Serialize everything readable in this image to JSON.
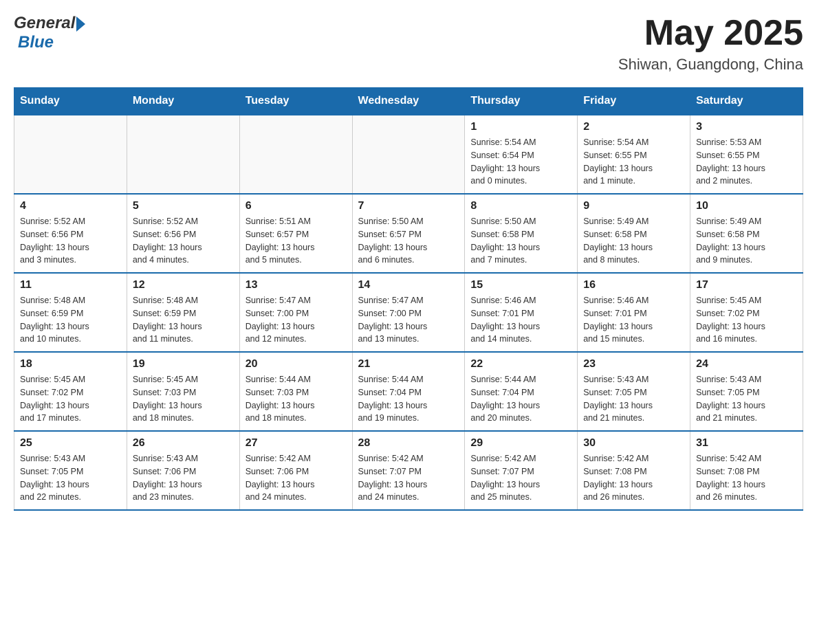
{
  "header": {
    "logo_general": "General",
    "logo_blue": "Blue",
    "month_year": "May 2025",
    "location": "Shiwan, Guangdong, China"
  },
  "weekdays": [
    "Sunday",
    "Monday",
    "Tuesday",
    "Wednesday",
    "Thursday",
    "Friday",
    "Saturday"
  ],
  "weeks": [
    [
      {
        "day": "",
        "info": ""
      },
      {
        "day": "",
        "info": ""
      },
      {
        "day": "",
        "info": ""
      },
      {
        "day": "",
        "info": ""
      },
      {
        "day": "1",
        "info": "Sunrise: 5:54 AM\nSunset: 6:54 PM\nDaylight: 13 hours\nand 0 minutes."
      },
      {
        "day": "2",
        "info": "Sunrise: 5:54 AM\nSunset: 6:55 PM\nDaylight: 13 hours\nand 1 minute."
      },
      {
        "day": "3",
        "info": "Sunrise: 5:53 AM\nSunset: 6:55 PM\nDaylight: 13 hours\nand 2 minutes."
      }
    ],
    [
      {
        "day": "4",
        "info": "Sunrise: 5:52 AM\nSunset: 6:56 PM\nDaylight: 13 hours\nand 3 minutes."
      },
      {
        "day": "5",
        "info": "Sunrise: 5:52 AM\nSunset: 6:56 PM\nDaylight: 13 hours\nand 4 minutes."
      },
      {
        "day": "6",
        "info": "Sunrise: 5:51 AM\nSunset: 6:57 PM\nDaylight: 13 hours\nand 5 minutes."
      },
      {
        "day": "7",
        "info": "Sunrise: 5:50 AM\nSunset: 6:57 PM\nDaylight: 13 hours\nand 6 minutes."
      },
      {
        "day": "8",
        "info": "Sunrise: 5:50 AM\nSunset: 6:58 PM\nDaylight: 13 hours\nand 7 minutes."
      },
      {
        "day": "9",
        "info": "Sunrise: 5:49 AM\nSunset: 6:58 PM\nDaylight: 13 hours\nand 8 minutes."
      },
      {
        "day": "10",
        "info": "Sunrise: 5:49 AM\nSunset: 6:58 PM\nDaylight: 13 hours\nand 9 minutes."
      }
    ],
    [
      {
        "day": "11",
        "info": "Sunrise: 5:48 AM\nSunset: 6:59 PM\nDaylight: 13 hours\nand 10 minutes."
      },
      {
        "day": "12",
        "info": "Sunrise: 5:48 AM\nSunset: 6:59 PM\nDaylight: 13 hours\nand 11 minutes."
      },
      {
        "day": "13",
        "info": "Sunrise: 5:47 AM\nSunset: 7:00 PM\nDaylight: 13 hours\nand 12 minutes."
      },
      {
        "day": "14",
        "info": "Sunrise: 5:47 AM\nSunset: 7:00 PM\nDaylight: 13 hours\nand 13 minutes."
      },
      {
        "day": "15",
        "info": "Sunrise: 5:46 AM\nSunset: 7:01 PM\nDaylight: 13 hours\nand 14 minutes."
      },
      {
        "day": "16",
        "info": "Sunrise: 5:46 AM\nSunset: 7:01 PM\nDaylight: 13 hours\nand 15 minutes."
      },
      {
        "day": "17",
        "info": "Sunrise: 5:45 AM\nSunset: 7:02 PM\nDaylight: 13 hours\nand 16 minutes."
      }
    ],
    [
      {
        "day": "18",
        "info": "Sunrise: 5:45 AM\nSunset: 7:02 PM\nDaylight: 13 hours\nand 17 minutes."
      },
      {
        "day": "19",
        "info": "Sunrise: 5:45 AM\nSunset: 7:03 PM\nDaylight: 13 hours\nand 18 minutes."
      },
      {
        "day": "20",
        "info": "Sunrise: 5:44 AM\nSunset: 7:03 PM\nDaylight: 13 hours\nand 18 minutes."
      },
      {
        "day": "21",
        "info": "Sunrise: 5:44 AM\nSunset: 7:04 PM\nDaylight: 13 hours\nand 19 minutes."
      },
      {
        "day": "22",
        "info": "Sunrise: 5:44 AM\nSunset: 7:04 PM\nDaylight: 13 hours\nand 20 minutes."
      },
      {
        "day": "23",
        "info": "Sunrise: 5:43 AM\nSunset: 7:05 PM\nDaylight: 13 hours\nand 21 minutes."
      },
      {
        "day": "24",
        "info": "Sunrise: 5:43 AM\nSunset: 7:05 PM\nDaylight: 13 hours\nand 21 minutes."
      }
    ],
    [
      {
        "day": "25",
        "info": "Sunrise: 5:43 AM\nSunset: 7:05 PM\nDaylight: 13 hours\nand 22 minutes."
      },
      {
        "day": "26",
        "info": "Sunrise: 5:43 AM\nSunset: 7:06 PM\nDaylight: 13 hours\nand 23 minutes."
      },
      {
        "day": "27",
        "info": "Sunrise: 5:42 AM\nSunset: 7:06 PM\nDaylight: 13 hours\nand 24 minutes."
      },
      {
        "day": "28",
        "info": "Sunrise: 5:42 AM\nSunset: 7:07 PM\nDaylight: 13 hours\nand 24 minutes."
      },
      {
        "day": "29",
        "info": "Sunrise: 5:42 AM\nSunset: 7:07 PM\nDaylight: 13 hours\nand 25 minutes."
      },
      {
        "day": "30",
        "info": "Sunrise: 5:42 AM\nSunset: 7:08 PM\nDaylight: 13 hours\nand 26 minutes."
      },
      {
        "day": "31",
        "info": "Sunrise: 5:42 AM\nSunset: 7:08 PM\nDaylight: 13 hours\nand 26 minutes."
      }
    ]
  ]
}
